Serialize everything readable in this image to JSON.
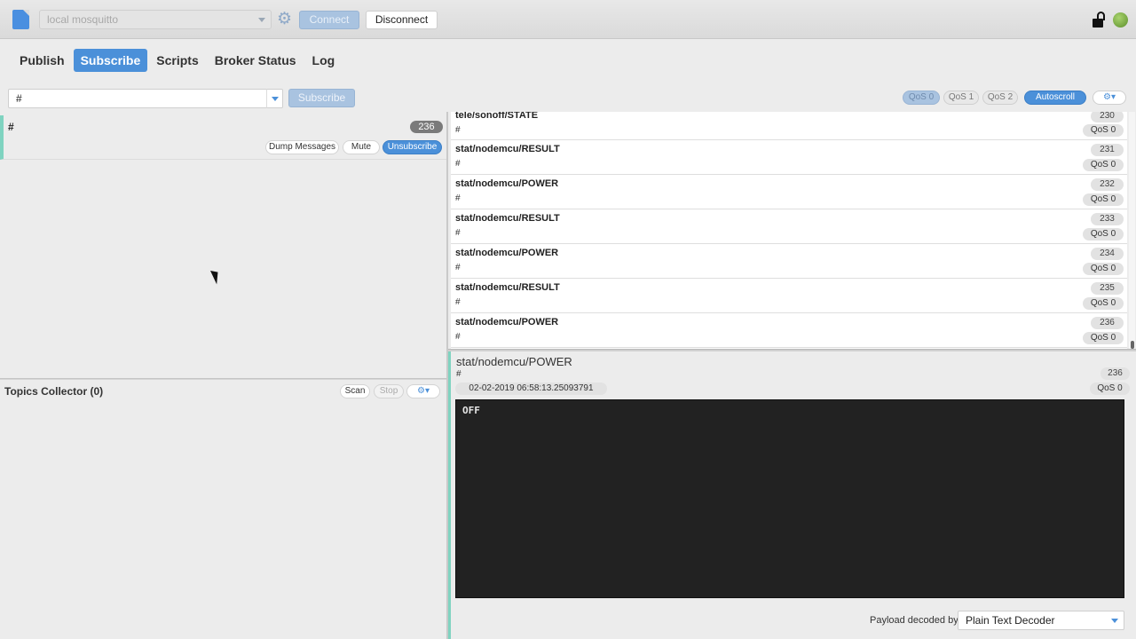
{
  "toolbar": {
    "connection_profile": "local mosquitto",
    "connect_label": "Connect",
    "disconnect_label": "Disconnect"
  },
  "tabs": [
    {
      "label": "Publish"
    },
    {
      "label": "Subscribe"
    },
    {
      "label": "Scripts"
    },
    {
      "label": "Broker Status"
    },
    {
      "label": "Log"
    }
  ],
  "active_tab": "Subscribe",
  "subscribe_bar": {
    "topic_value": "#",
    "subscribe_label": "Subscribe",
    "qos_options": [
      "QoS 0",
      "QoS 1",
      "QoS 2"
    ],
    "selected_qos": "QoS 0",
    "autoscroll_label": "Autoscroll"
  },
  "subscriptions": [
    {
      "topic": "#",
      "count": "236",
      "dump_label": "Dump Messages",
      "mute_label": "Mute",
      "unsubscribe_label": "Unsubscribe"
    }
  ],
  "topics_collector": {
    "title": "Topics Collector (0)",
    "scan_label": "Scan",
    "stop_label": "Stop"
  },
  "messages": [
    {
      "topic": "tele/sonoff/STATE",
      "sub": "#",
      "num": "230",
      "qos": "QoS 0"
    },
    {
      "topic": "stat/nodemcu/RESULT",
      "sub": "#",
      "num": "231",
      "qos": "QoS 0"
    },
    {
      "topic": "stat/nodemcu/POWER",
      "sub": "#",
      "num": "232",
      "qos": "QoS 0"
    },
    {
      "topic": "stat/nodemcu/RESULT",
      "sub": "#",
      "num": "233",
      "qos": "QoS 0"
    },
    {
      "topic": "stat/nodemcu/POWER",
      "sub": "#",
      "num": "234",
      "qos": "QoS 0"
    },
    {
      "topic": "stat/nodemcu/RESULT",
      "sub": "#",
      "num": "235",
      "qos": "QoS 0"
    },
    {
      "topic": "stat/nodemcu/POWER",
      "sub": "#",
      "num": "236",
      "qos": "QoS 0"
    }
  ],
  "detail": {
    "topic": "stat/nodemcu/POWER",
    "sub": "#",
    "num": "236",
    "timestamp": "02-02-2019  06:58:13.25093791",
    "qos": "QoS 0",
    "payload": "OFF",
    "decoder_label": "Payload decoded by",
    "decoder_value": "Plain Text Decoder"
  },
  "icons": {
    "file": "file-icon",
    "settings": "gear-icon",
    "lock": "lock-icon",
    "status": "status-dot-icon"
  },
  "colors": {
    "accent": "#4b90d9",
    "subscription_marker": "#7fd3c0",
    "connected": "#6fa63a"
  }
}
